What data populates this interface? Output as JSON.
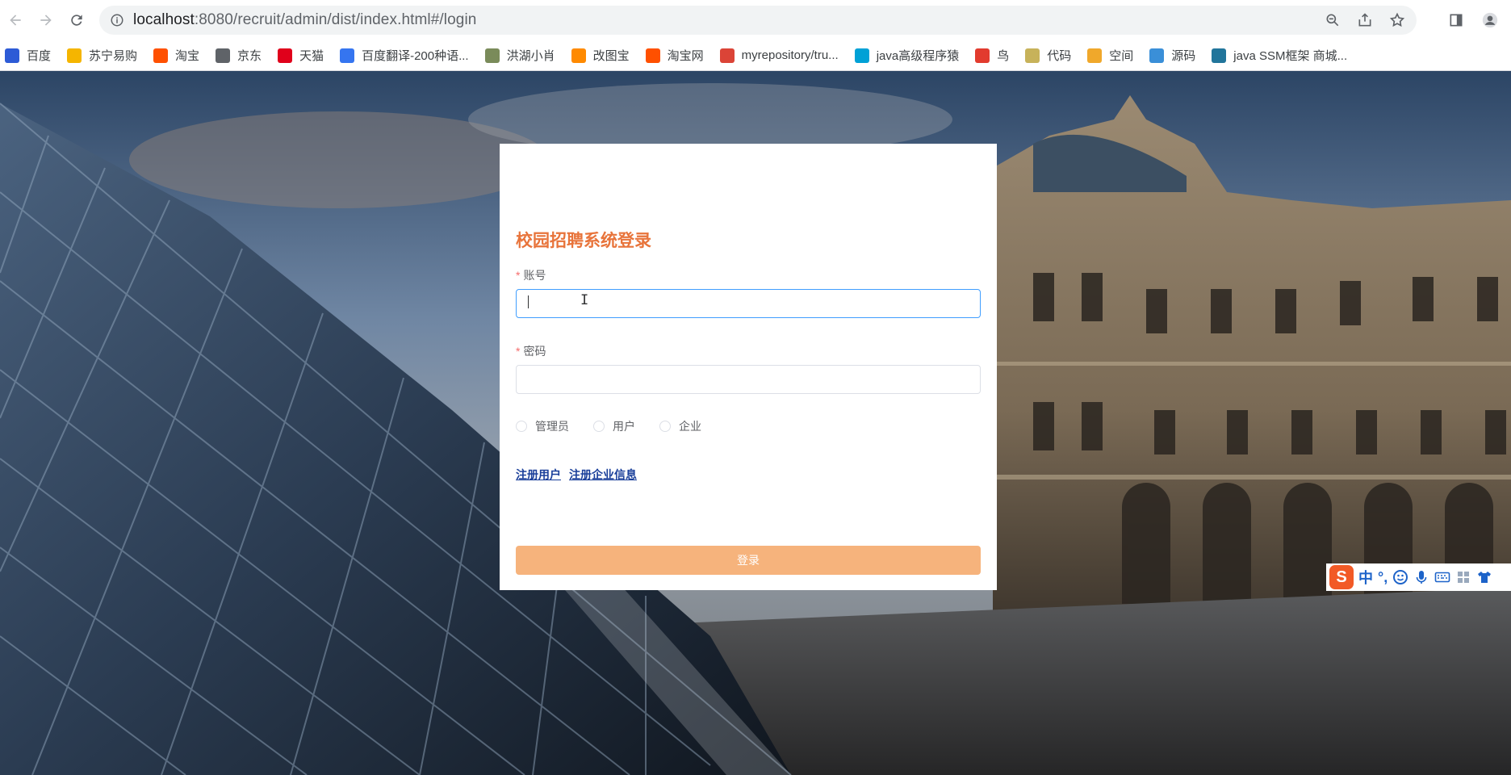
{
  "browser": {
    "url_host": "localhost",
    "url_rest": ":8080/recruit/admin/dist/index.html#/login"
  },
  "bookmarks": [
    {
      "label": "百度",
      "icon": "baidu-paw-icon",
      "color": "#2d5bd6"
    },
    {
      "label": "苏宁易购",
      "icon": "suning-icon",
      "color": "#f5b500"
    },
    {
      "label": "淘宝",
      "icon": "taobao-icon",
      "color": "#ff5000"
    },
    {
      "label": "京东",
      "icon": "globe-icon",
      "color": "#5f6368"
    },
    {
      "label": "天猫",
      "icon": "tmall-icon",
      "color": "#e0001b"
    },
    {
      "label": "百度翻译-200种语...",
      "icon": "baidu-translate-icon",
      "color": "#3575f0"
    },
    {
      "label": "洪湖小肖",
      "icon": "feather-icon",
      "color": "#7a8b5a"
    },
    {
      "label": "改图宝",
      "icon": "gaitubao-icon",
      "color": "#ff8a00"
    },
    {
      "label": "淘宝网",
      "icon": "taobao-icon",
      "color": "#ff5000"
    },
    {
      "label": "myrepository/tru...",
      "icon": "chrome-icon",
      "color": "#db4437"
    },
    {
      "label": "java高级程序猿",
      "icon": "bilibili-icon",
      "color": "#00a1d6"
    },
    {
      "label": "鸟",
      "icon": "bird-icon",
      "color": "#e23b2e"
    },
    {
      "label": "代码",
      "icon": "code-leaf-icon",
      "color": "#c7b25a"
    },
    {
      "label": "空间",
      "icon": "qzone-icon",
      "color": "#f0a82b"
    },
    {
      "label": "源码",
      "icon": "source-fish-icon",
      "color": "#3a8fd8"
    },
    {
      "label": "java SSM框架 商城...",
      "icon": "wordpress-icon",
      "color": "#21759b"
    }
  ],
  "login": {
    "title": "校园招聘系统登录",
    "account_label": "账号",
    "password_label": "密码",
    "required_mark": "*",
    "account_value": "",
    "password_value": "",
    "roles": [
      "管理员",
      "用户",
      "企业"
    ],
    "register_user": "注册用户",
    "register_company": "注册企业信息",
    "submit": "登录"
  },
  "ime": {
    "logo": "S",
    "mode": "中",
    "punct": "°,"
  },
  "colors": {
    "title": "#e8743b",
    "button": "#f6b37c",
    "link": "#1a3f9a",
    "focus_border": "#409eff"
  }
}
